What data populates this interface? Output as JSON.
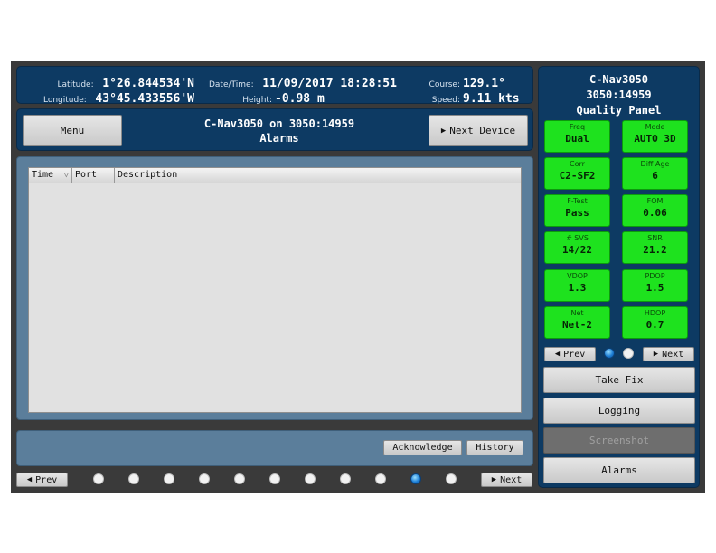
{
  "status": {
    "latitude_label": "Latitude:",
    "latitude_value": "1°26.844534'N",
    "longitude_label": "Longitude:",
    "longitude_value": "43°45.433556'W",
    "datetime_label": "Date/Time:",
    "datetime_value": "11/09/2017 18:28:51",
    "height_label": "Height:",
    "height_value": "-0.98 m",
    "course_label": "Course:",
    "course_value": "129.1°",
    "speed_label": "Speed:",
    "speed_value": "9.11 kts"
  },
  "header": {
    "menu_label": "Menu",
    "title_line1": "C-Nav3050 on 3050:14959",
    "title_line2": "Alarms",
    "next_device_label": "Next Device"
  },
  "alarms_table": {
    "columns": [
      "Time",
      "Port",
      "Description"
    ],
    "rows": []
  },
  "alarm_actions": {
    "acknowledge_label": "Acknowledge",
    "history_label": "History"
  },
  "pager": {
    "prev_label": "Prev",
    "next_label": "Next",
    "page_count": 11,
    "active_page": 10
  },
  "quality_panel": {
    "title_line1": "C-Nav3050",
    "title_line2": "3050:14959",
    "title_line3": "Quality Panel",
    "tiles": [
      {
        "label": "Freq",
        "value": "Dual"
      },
      {
        "label": "Mode",
        "value": "AUTO 3D"
      },
      {
        "label": "Corr",
        "value": "C2-SF2"
      },
      {
        "label": "Diff Age",
        "value": "6"
      },
      {
        "label": "F-Test",
        "value": "Pass"
      },
      {
        "label": "FOM",
        "value": "0.06"
      },
      {
        "label": "# SVS",
        "value": "14/22"
      },
      {
        "label": "SNR",
        "value": "21.2"
      },
      {
        "label": "VDOP",
        "value": "1.3"
      },
      {
        "label": "PDOP",
        "value": "1.5"
      },
      {
        "label": "Net",
        "value": "Net-2"
      },
      {
        "label": "HDOP",
        "value": "0.7"
      }
    ],
    "prev_label": "Prev",
    "next_label": "Next",
    "page_count": 2,
    "active_page": 1,
    "take_fix_label": "Take Fix",
    "logging_label": "Logging",
    "screenshot_label": "Screenshot",
    "alarms_label": "Alarms"
  },
  "colors": {
    "panel_navy": "#0d3a63",
    "content_steel": "#5b7e9b",
    "status_green": "#1ee21e",
    "active_dot_blue": "#1e7fd6"
  }
}
